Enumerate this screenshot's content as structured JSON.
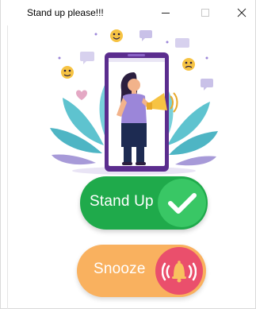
{
  "window": {
    "title": "Stand up please!!!",
    "minimize_glyph": "—",
    "maximize_glyph": "☐",
    "close_glyph": "✕"
  },
  "illustration": {
    "subject": "woman-with-megaphone-in-phone"
  },
  "buttons": {
    "standup_label": "Stand Up",
    "standup_icon": "check-icon",
    "snooze_label": "Snooze",
    "snooze_icon": "ringing-bell-icon"
  },
  "colors": {
    "standup_bg": "#1faa4b",
    "standup_circle": "#39c765",
    "snooze_bg": "#f9b15f",
    "snooze_circle": "#ea4f6c",
    "phone_frame": "#5b2d8e",
    "leaves": "#5ec3cf"
  }
}
